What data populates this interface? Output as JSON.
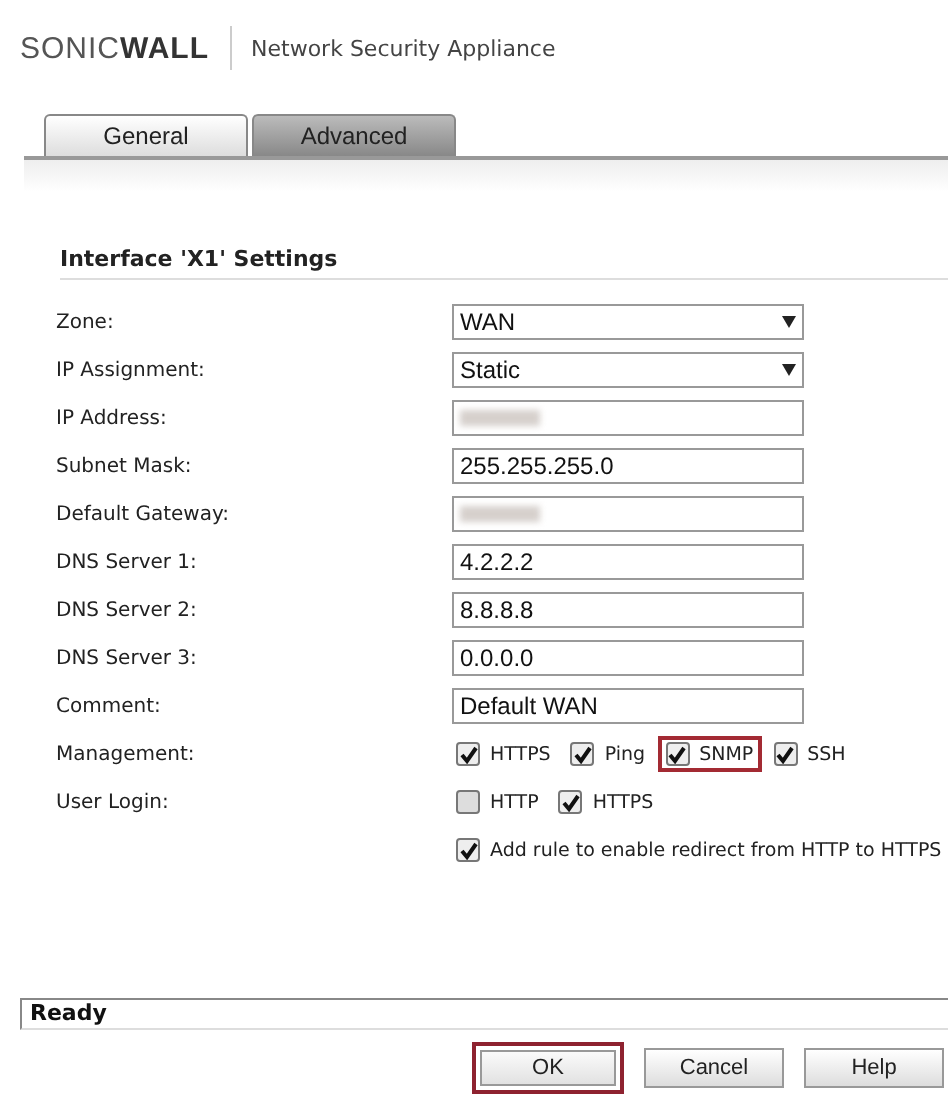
{
  "header": {
    "logo": "SONIC**WALL**",
    "product": "Network Security Appliance"
  },
  "tabs": [
    {
      "label": "General",
      "selected": true
    },
    {
      "label": "Advanced",
      "selected": false
    }
  ],
  "section_title": "Interface 'X1' Settings",
  "fields": [
    {
      "label": "Zone:",
      "kind": "select",
      "value": "WAN"
    },
    {
      "label": "IP Assignment:",
      "kind": "select",
      "value": "Static"
    },
    {
      "label": "IP Address:",
      "kind": "redacted"
    },
    {
      "label": "Subnet Mask:",
      "kind": "text",
      "value": "255.255.255.0"
    },
    {
      "label": "Default Gateway:",
      "kind": "redacted"
    },
    {
      "label": "DNS Server 1:",
      "kind": "text",
      "value": "4.2.2.2"
    },
    {
      "label": "DNS Server 2:",
      "kind": "text",
      "value": "8.8.8.8"
    },
    {
      "label": "DNS Server 3:",
      "kind": "text",
      "value": "0.0.0.0"
    },
    {
      "label": "Comment:",
      "kind": "text",
      "value": "Default WAN"
    },
    {
      "label": "Management:",
      "kind": "checks",
      "options": [
        {
          "label": "HTTPS",
          "checked": true,
          "highlighted": false
        },
        {
          "label": "Ping",
          "checked": true,
          "highlighted": false
        },
        {
          "label": "SNMP",
          "checked": true,
          "highlighted": true
        },
        {
          "label": "SSH",
          "checked": true,
          "highlighted": false
        }
      ]
    },
    {
      "label": "User Login:",
      "kind": "checks",
      "options": [
        {
          "label": "HTTP",
          "checked": false,
          "highlighted": false
        },
        {
          "label": "HTTPS",
          "checked": true,
          "highlighted": false
        }
      ]
    },
    {
      "kind": "checks",
      "options": [
        {
          "label": "Add rule to enable redirect from HTTP to HTTPS",
          "checked": true,
          "highlighted": false
        }
      ]
    }
  ],
  "status_bar": "Ready",
  "buttons": [
    {
      "label": "OK",
      "highlighted": true
    },
    {
      "label": "Cancel",
      "highlighted": false
    },
    {
      "label": "Help",
      "highlighted": false
    }
  ]
}
